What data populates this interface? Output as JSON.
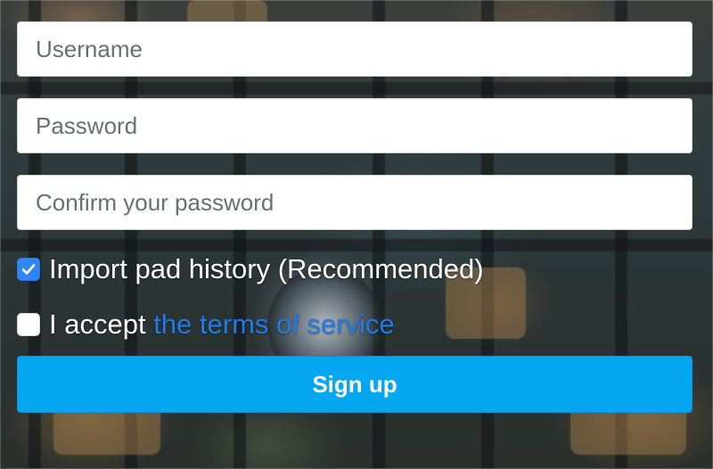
{
  "form": {
    "username": {
      "placeholder": "Username",
      "value": ""
    },
    "password": {
      "placeholder": "Password",
      "value": ""
    },
    "confirm_password": {
      "placeholder": "Confirm your password",
      "value": ""
    },
    "import_history": {
      "label": "Import pad history (Recommended)",
      "checked": true
    },
    "accept_terms": {
      "label_prefix": "I accept ",
      "link_text": "the terms of service",
      "checked": false
    },
    "submit_label": "Sign up"
  },
  "colors": {
    "checkbox_checked": "#2f86f6",
    "link": "#1e7be8",
    "button": "#05a8f0",
    "label_text": "#ffffff"
  },
  "icons": {
    "checked": "checkmark-icon"
  }
}
